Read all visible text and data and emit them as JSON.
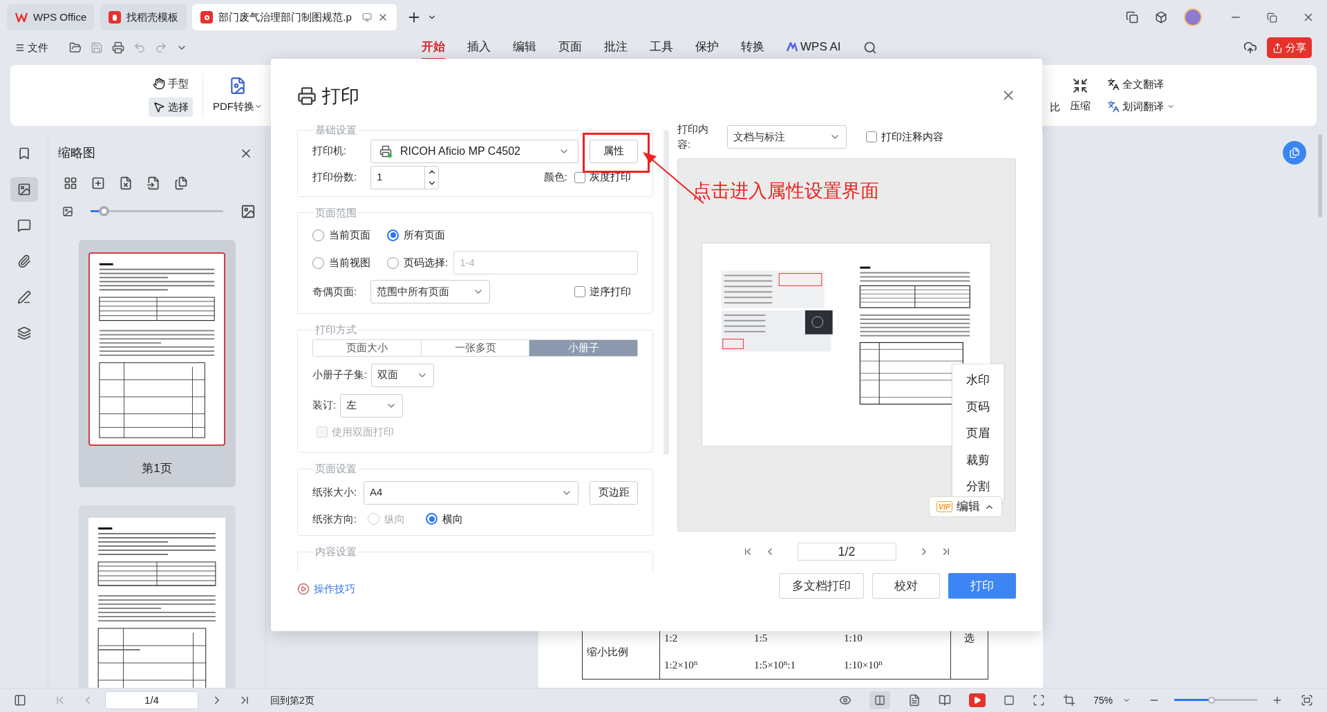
{
  "tabs": [
    {
      "label": "WPS Office",
      "kind": "home",
      "selected": false
    },
    {
      "label": "找稻壳模板",
      "kind": "template",
      "selected": false
    },
    {
      "label": "部门废气治理部门制图规范.p",
      "kind": "pdf",
      "selected": true
    }
  ],
  "menu": {
    "file": "文件",
    "items": [
      {
        "label": "开始",
        "selected": true
      },
      {
        "label": "插入",
        "selected": false
      },
      {
        "label": "编辑",
        "selected": false
      },
      {
        "label": "页面",
        "selected": false
      },
      {
        "label": "批注",
        "selected": false
      },
      {
        "label": "工具",
        "selected": false
      },
      {
        "label": "保护",
        "selected": false
      },
      {
        "label": "转换",
        "selected": false
      },
      {
        "label": "WPS AI",
        "selected": false
      }
    ],
    "share": "分享"
  },
  "ribbon": {
    "hand": {
      "label": "手型",
      "selected": false
    },
    "select": {
      "label": "选择",
      "selected": true
    },
    "pdf_convert": "PDF转换",
    "compare": "比",
    "compress": "压缩",
    "translate_full": "全文翻译",
    "translate_word": "划词翻译"
  },
  "sidebar_tools": [
    {
      "kind": "bookmark",
      "selected": false
    },
    {
      "kind": "thumbnail",
      "selected": true
    },
    {
      "kind": "comment",
      "selected": false
    },
    {
      "kind": "attachment",
      "selected": false
    },
    {
      "kind": "signature",
      "selected": false
    },
    {
      "kind": "layers",
      "selected": false
    }
  ],
  "thumbnails": {
    "title": "缩略图",
    "slider": {
      "level": 0.1
    },
    "pages": [
      {
        "label": "第1页",
        "selected": true
      },
      {
        "selected": false
      }
    ]
  },
  "document_table": {
    "row_label": "缩小比例",
    "values": [
      "1:2",
      "1:5",
      "1:10"
    ],
    "values_2": [
      "1:2×10$^{n}$",
      "1:5×10$^{n}$:1",
      "1:10×10$^{n}$"
    ],
    "note": "选"
  },
  "dialog": {
    "title": "打印",
    "basic": {
      "legend": "基础设置",
      "printer_label": "打印机:",
      "printer": "RICOH Aficio MP C4502",
      "properties": "属性",
      "copies_label": "打印份数:",
      "copies": "1",
      "color_label": "颜色:",
      "grayscale": {
        "label": "灰度打印",
        "checked": false
      }
    },
    "range": {
      "legend": "页面范围",
      "options": [
        {
          "label": "当前页面",
          "selected": false
        },
        {
          "label": "所有页面",
          "selected": true
        },
        {
          "label": "当前视图",
          "selected": false
        },
        {
          "label": "页码选择:",
          "selected": false
        }
      ],
      "pages_placeholder": "1-4",
      "odd_even_label": "奇偶页面:",
      "odd_even": "范围中所有页面",
      "reverse": {
        "label": "逆序打印",
        "checked": false
      }
    },
    "mode": {
      "legend": "打印方式",
      "tabs": [
        {
          "label": "页面大小",
          "selected": false
        },
        {
          "label": "一张多页",
          "selected": false
        },
        {
          "label": "小册子",
          "selected": true
        }
      ],
      "subset_label": "小册子子集:",
      "subset": "双面",
      "binding_label": "装订:",
      "binding": "左",
      "duplex": {
        "label": "使用双面打印",
        "checked": false,
        "disabled": true
      }
    },
    "page_setup": {
      "legend": "页面设置",
      "paper_label": "纸张大小:",
      "paper": "A4",
      "margins": "页边距",
      "orientation_label": "纸张方向:",
      "orientations": [
        {
          "label": "纵向",
          "selected": false,
          "disabled": true
        },
        {
          "label": "横向",
          "selected": true,
          "disabled": false
        }
      ]
    },
    "content_legend": "内容设置",
    "tips": "操作技巧",
    "print_content_label": "打印内容:",
    "print_content": "文档与标注",
    "print_comments": {
      "label": "打印注释内容",
      "checked": false
    },
    "edit_menu": [
      "水印",
      "页码",
      "页眉",
      "裁剪",
      "分割"
    ],
    "vip": "VIP",
    "edit": "编辑",
    "pager": "1/2",
    "buttons": [
      {
        "label": "多文档打印",
        "kind": "normal"
      },
      {
        "label": "校对",
        "kind": "normal"
      },
      {
        "label": "打印",
        "kind": "primary"
      }
    ]
  },
  "annotation": "点击进入属性设置界面",
  "status_bar": {
    "page": "1/4",
    "goto": "回到第2页",
    "zoom": "75%",
    "zoom_slider": {
      "level": 0.45
    }
  }
}
